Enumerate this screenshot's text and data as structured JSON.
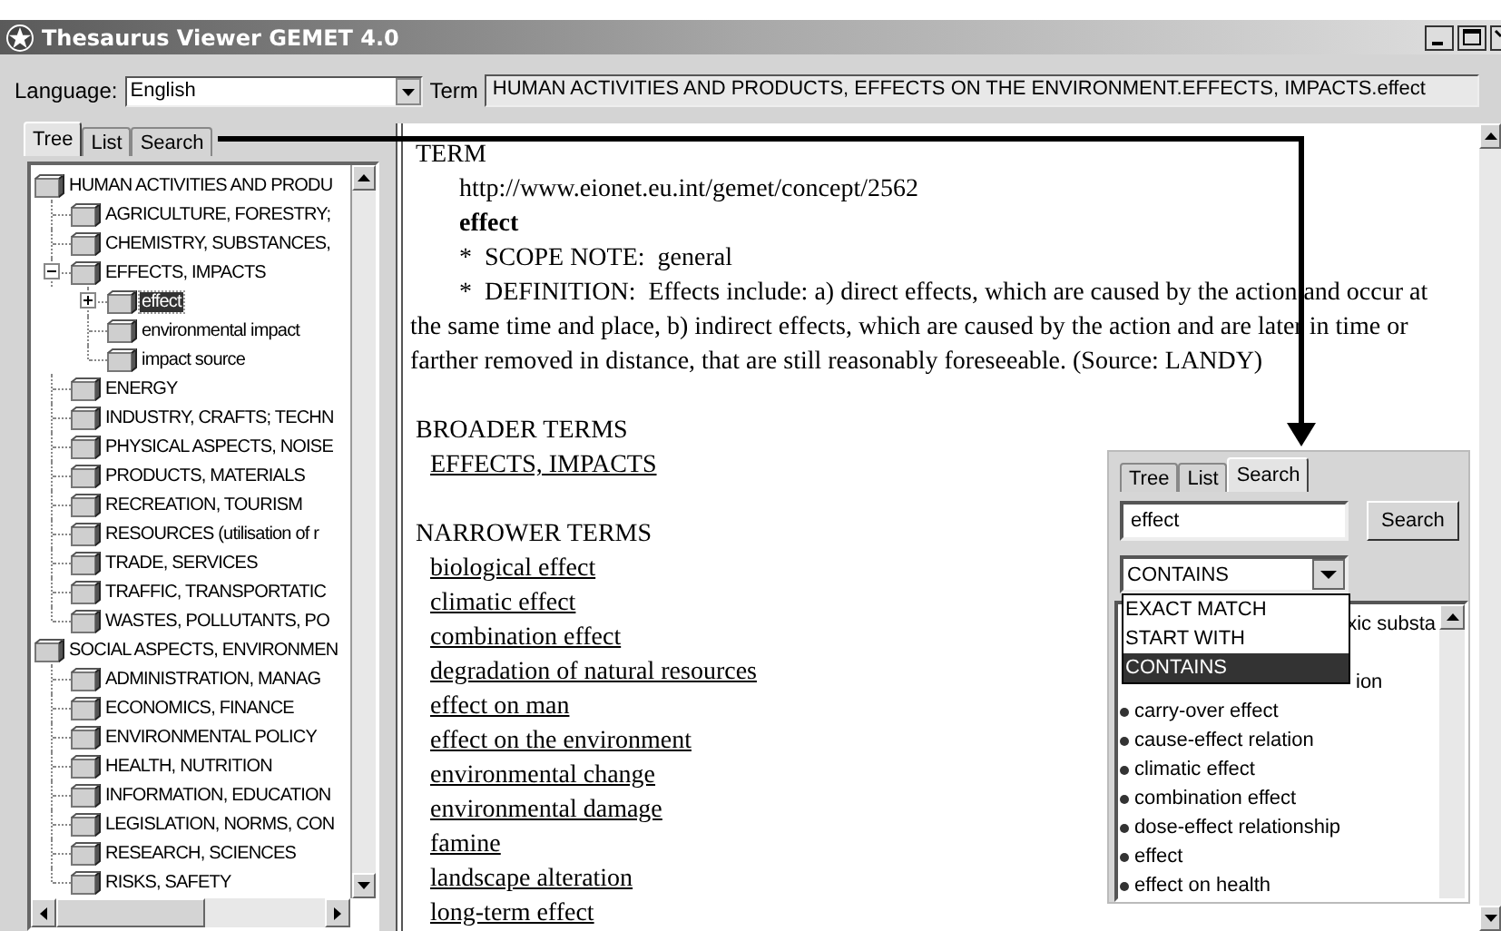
{
  "window": {
    "title": "Thesaurus Viewer GEMET 4.0"
  },
  "toolbar": {
    "language_label": "Language:",
    "language": "English",
    "term_label": "Term",
    "term": "HUMAN ACTIVITIES AND PRODUCTS, EFFECTS ON THE ENVIRONMENT.EFFECTS, IMPACTS.effect"
  },
  "tabs": [
    {
      "label": "Tree",
      "selected": true
    },
    {
      "label": "List",
      "selected": false
    },
    {
      "label": "Search",
      "selected": false
    }
  ],
  "tree": [
    {
      "label": "HUMAN ACTIVITIES AND PRODU",
      "selected": false,
      "children": [
        {
          "label": "AGRICULTURE, FORESTRY;",
          "selected": false
        },
        {
          "label": "CHEMISTRY, SUBSTANCES,",
          "selected": false
        },
        {
          "label": "EFFECTS, IMPACTS",
          "selected": false,
          "expanded": true,
          "children": [
            {
              "label": "effect",
              "selected": true,
              "expanded": false
            },
            {
              "label": "environmental impact",
              "selected": false
            },
            {
              "label": "impact source",
              "selected": false
            }
          ]
        },
        {
          "label": "ENERGY",
          "selected": false
        },
        {
          "label": "INDUSTRY, CRAFTS; TECHN",
          "selected": false
        },
        {
          "label": "PHYSICAL ASPECTS, NOISE",
          "selected": false
        },
        {
          "label": "PRODUCTS, MATERIALS",
          "selected": false
        },
        {
          "label": "RECREATION, TOURISM",
          "selected": false
        },
        {
          "label": "RESOURCES (utilisation of r",
          "selected": false
        },
        {
          "label": "TRADE, SERVICES",
          "selected": false
        },
        {
          "label": "TRAFFIC, TRANSPORTATIC",
          "selected": false
        },
        {
          "label": "WASTES, POLLUTANTS, PO",
          "selected": false
        }
      ]
    },
    {
      "label": "SOCIAL ASPECTS, ENVIRONMEN",
      "selected": false,
      "children": [
        {
          "label": "ADMINISTRATION, MANAG",
          "selected": false
        },
        {
          "label": "ECONOMICS, FINANCE",
          "selected": false
        },
        {
          "label": "ENVIRONMENTAL POLICY",
          "selected": false
        },
        {
          "label": "HEALTH, NUTRITION",
          "selected": false
        },
        {
          "label": "INFORMATION, EDUCATION",
          "selected": false
        },
        {
          "label": "LEGISLATION, NORMS, CON",
          "selected": false
        },
        {
          "label": "RESEARCH, SCIENCES",
          "selected": false
        },
        {
          "label": "RISKS, SAFETY",
          "selected": false
        }
      ]
    }
  ],
  "content": {
    "heading": "TERM",
    "uri": "http://www.eionet.eu.int/gemet/concept/2562",
    "name": "effect",
    "scope_note": "*  SCOPE NOTE:  general",
    "definition": "*  DEFINITION:  Effects include: a) direct effects, which are caused by the action and occur at the same time and place, b) indirect effects, which are caused by the action and are later in time or farther removed in distance, that are still reasonably foreseeable. (Source: LANDY)",
    "broader_heading": "BROADER TERMS",
    "broader": [
      "EFFECTS, IMPACTS"
    ],
    "narrower_heading": "NARROWER TERMS",
    "narrower": [
      "biological effect",
      "climatic effect",
      "combination effect",
      "degradation of natural resources",
      "effect on man",
      "effect on the environment",
      "environmental change",
      "environmental damage",
      "famine",
      "landscape alteration",
      "long-term effect"
    ]
  },
  "inset": {
    "tabs": [
      {
        "label": "Tree",
        "selected": false
      },
      {
        "label": "List",
        "selected": false
      },
      {
        "label": "Search",
        "selected": true
      }
    ],
    "query": "effect",
    "search_button": "Search",
    "mode": "CONTAINS",
    "options": [
      {
        "label": "EXACT MATCH",
        "selected": false
      },
      {
        "label": "START WITH",
        "selected": false
      },
      {
        "label": "CONTAINS",
        "selected": true
      }
    ],
    "results": [
      {
        "text": "xic substa",
        "covered": true
      },
      {
        "text": "ion",
        "covered": true
      },
      {
        "text": "carry-over effect"
      },
      {
        "text": "cause-effect relation"
      },
      {
        "text": "climatic effect"
      },
      {
        "text": "combination effect"
      },
      {
        "text": "dose-effect relationship"
      },
      {
        "text": "effect"
      },
      {
        "text": "effect on health"
      }
    ]
  }
}
